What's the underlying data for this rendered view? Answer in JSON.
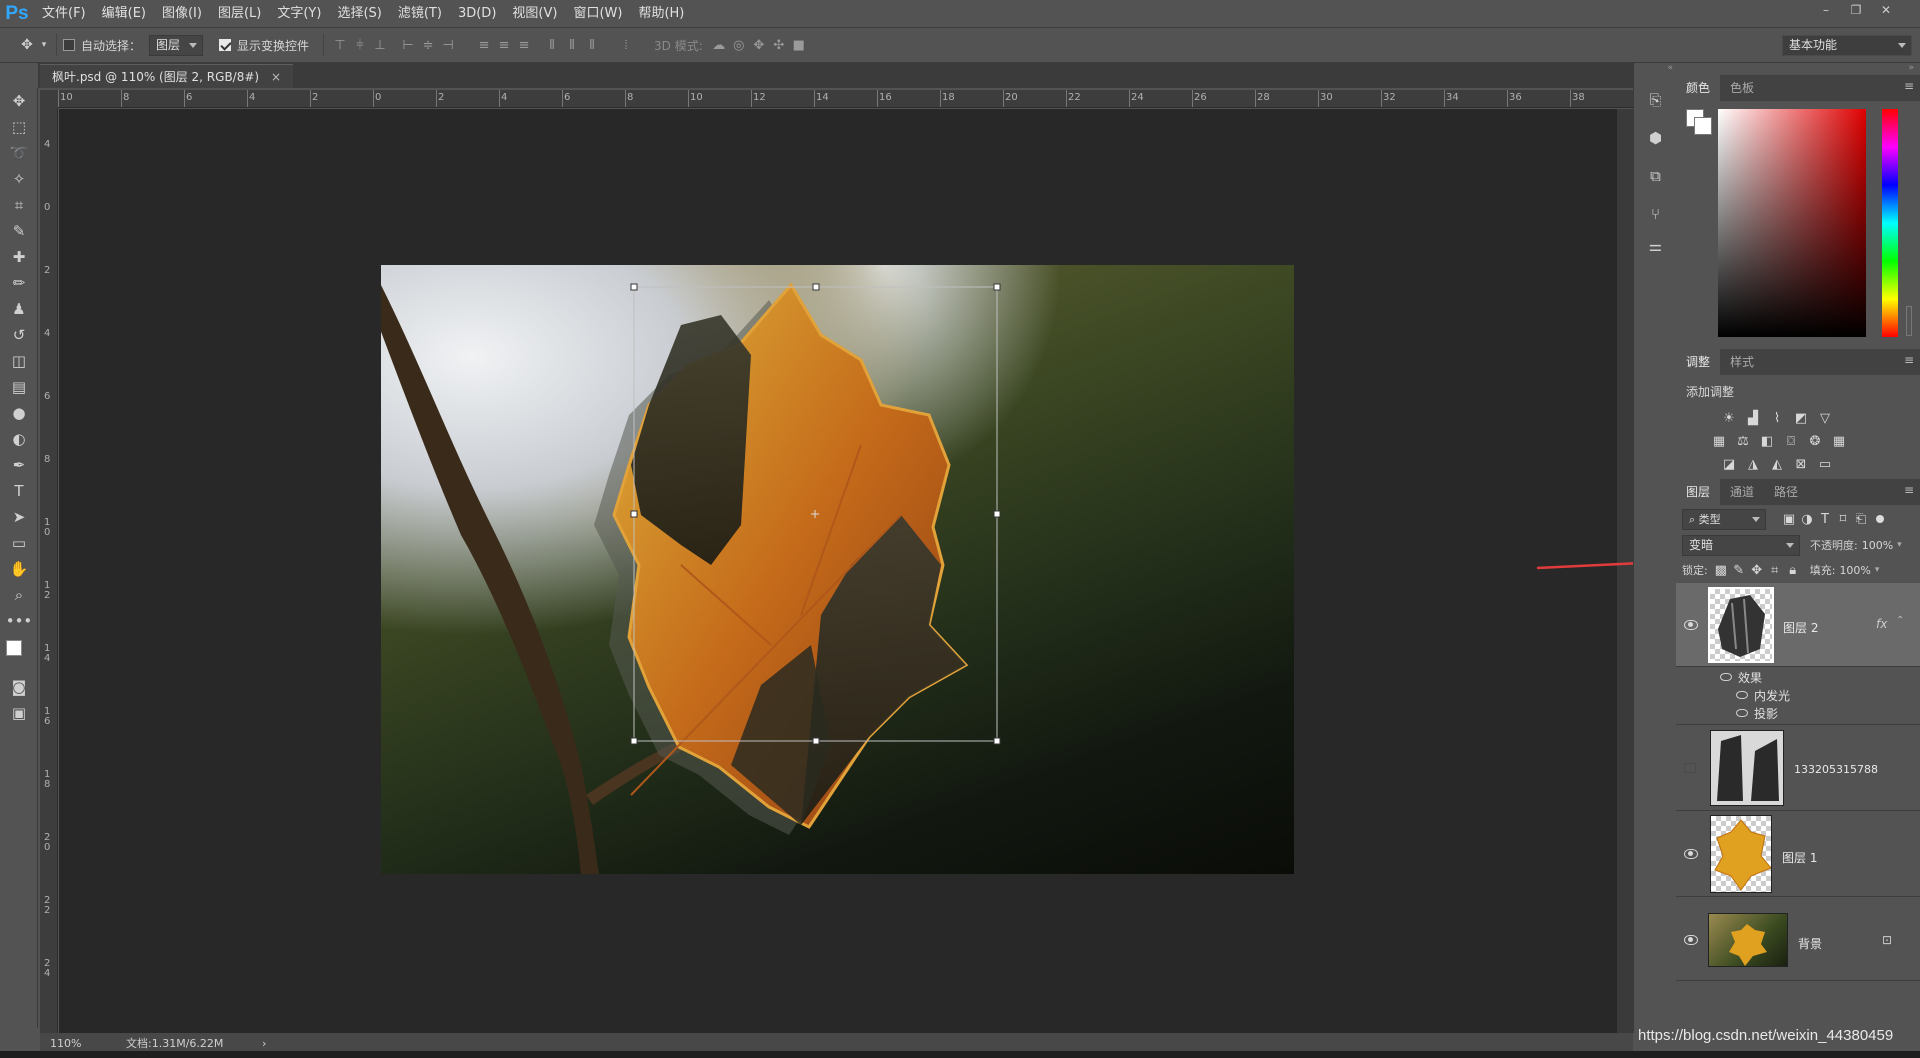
{
  "app": {
    "logo": "Ps"
  },
  "menu": [
    "文件(F)",
    "编辑(E)",
    "图像(I)",
    "图层(L)",
    "文字(Y)",
    "选择(S)",
    "滤镜(T)",
    "3D(D)",
    "视图(V)",
    "窗口(W)",
    "帮助(H)"
  ],
  "window_controls": [
    "–",
    "❐",
    "✕"
  ],
  "options": {
    "auto_select_label": "自动选择：",
    "auto_select_value": "图层",
    "show_transform_label": "显示变换控件",
    "mode_3d_label": "3D 模式:",
    "workspace": "基本功能"
  },
  "document": {
    "tab_title": "枫叶.psd @ 110% (图层 2, RGB/8#)",
    "close": "×"
  },
  "ruler_h_ticks": [
    "10",
    "8",
    "6",
    "4",
    "2",
    "0",
    "2",
    "4",
    "6",
    "8",
    "10",
    "12",
    "14",
    "16",
    "18",
    "20",
    "22",
    "24",
    "26",
    "28",
    "30",
    "32",
    "34",
    "36",
    "38"
  ],
  "ruler_v_ticks": [
    "4",
    "0",
    "2",
    "4",
    "6",
    "8",
    "1\n0",
    "1\n2",
    "1\n4",
    "1\n6",
    "1\n8",
    "2\n0",
    "2\n2",
    "2\n4"
  ],
  "status": {
    "zoom": "110%",
    "doc": "文档:1.31M/6.22M",
    "arrow": "›"
  },
  "panels": {
    "color_tabs": [
      "颜色",
      "色板"
    ],
    "adjust_tabs": [
      "调整",
      "样式"
    ],
    "adjust_title": "添加调整",
    "layers_tabs": [
      "图层",
      "通道",
      "路径"
    ],
    "filter_kind": "类型",
    "blend_mode": "变暗",
    "opacity_label": "不透明度:",
    "opacity_value": "100%",
    "lock_label": "锁定:",
    "fill_label": "填充:",
    "fill_value": "100%"
  },
  "layers": [
    {
      "name": "图层 2",
      "fx": "fx",
      "selected": true
    },
    {
      "name": "133205315788",
      "selected": false
    },
    {
      "name": "图层 1",
      "selected": false
    },
    {
      "name": "背景",
      "selected": false
    }
  ],
  "effects": {
    "title": "效果",
    "items": [
      "内发光",
      "投影"
    ]
  },
  "watermark": "https://blog.csdn.net/weixin_44380459",
  "colors": {
    "accent": "#31a8ff",
    "annotation_arrow": "#e23b3b"
  }
}
